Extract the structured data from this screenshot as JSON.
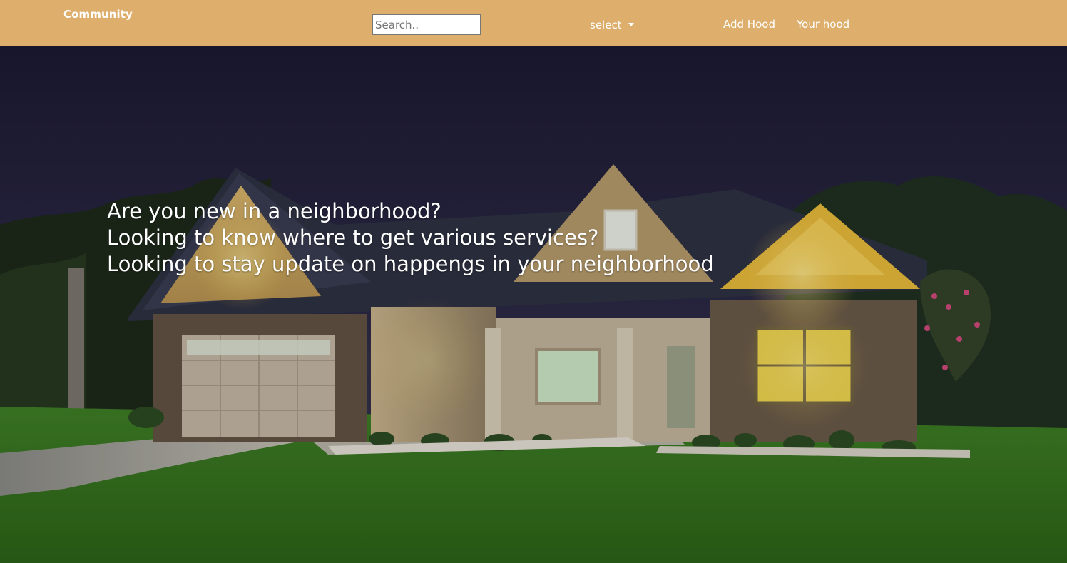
{
  "navbar": {
    "brand": "Community",
    "search": {
      "placeholder": "Search..",
      "value": ""
    },
    "select_label": "select",
    "links": {
      "add_hood": "Add Hood",
      "your_hood": "Your hood"
    },
    "background_color": "#deaf6c"
  },
  "hero": {
    "lines": [
      "Are you new in a neighborhood?",
      "Looking to know where to get various services?",
      "Looking to stay update on happengs in your neighborhood"
    ],
    "image_subject": "house-at-dusk-photo"
  }
}
